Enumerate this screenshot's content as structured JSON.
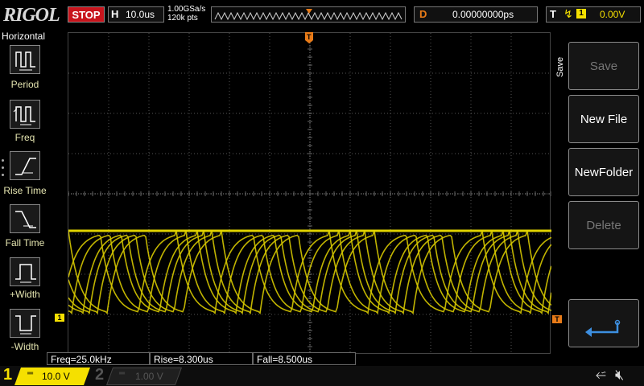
{
  "brand": {
    "logo": "RIGOL"
  },
  "topbar": {
    "run_state": "STOP",
    "horizontal_letter": "H",
    "timebase": "10.0us",
    "sample_rate": "1.00GSa/s",
    "memory_depth": "120k pts",
    "delay_letter": "D",
    "delay": "0.00000000ps",
    "trigger_letter": "T",
    "trigger_source": "1",
    "trigger_level": "0.00V",
    "trigger_position_label": "T"
  },
  "left_menu": {
    "title": "Horizontal",
    "items": [
      {
        "label": "Period",
        "icon": "period-icon"
      },
      {
        "label": "Freq",
        "icon": "frequency-icon"
      },
      {
        "label": "Rise Time",
        "icon": "rise-time-icon"
      },
      {
        "label": "Fall Time",
        "icon": "fall-time-icon"
      },
      {
        "label": "+Width",
        "icon": "positive-width-icon"
      },
      {
        "label": "-Width",
        "icon": "negative-width-icon"
      }
    ]
  },
  "right_menu": {
    "title": "Save",
    "buttons": [
      {
        "label": "Save",
        "enabled": false
      },
      {
        "label": "New File",
        "enabled": true
      },
      {
        "label": "NewFolder",
        "enabled": true
      },
      {
        "label": "Delete",
        "enabled": false
      }
    ],
    "return_icon": "return-arrow-icon"
  },
  "markers": {
    "ch1": "1",
    "trigger": "T"
  },
  "measurements": [
    {
      "label": "Freq=25.0kHz"
    },
    {
      "label": "Rise=8.300us"
    },
    {
      "label": "Fall=8.500us"
    }
  ],
  "channels": [
    {
      "number": "1",
      "coupling": "═",
      "scale": "10.0 V",
      "active": true
    },
    {
      "number": "2",
      "coupling": "═",
      "scale": "1.00 V",
      "active": false
    }
  ],
  "status_icons": {
    "usb": "usb-icon",
    "speaker": "speaker-muted-icon"
  },
  "colors": {
    "ch1": "#f5e000",
    "trigger": "#e87b18",
    "stop": "#c8141c"
  }
}
